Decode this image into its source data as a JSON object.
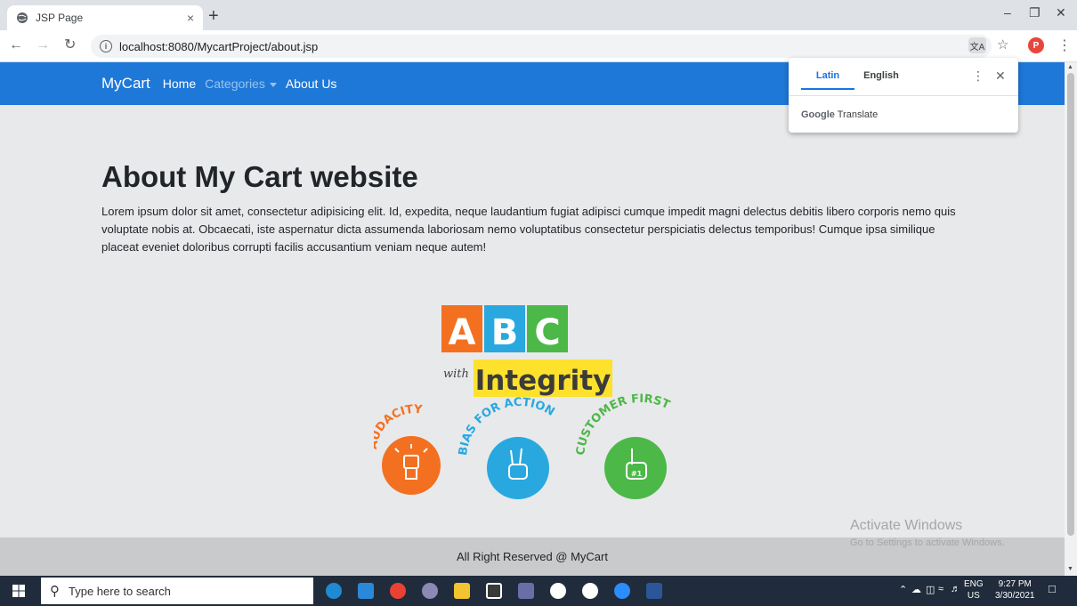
{
  "browser": {
    "tab_title": "JSP Page",
    "tab_close": "×",
    "new_tab": "+",
    "url": "localhost:8080/MycartProject/about.jsp",
    "profile_initial": "P",
    "translate_icon_text": "文A"
  },
  "site_nav": {
    "brand": "MyCart",
    "links": [
      "Home",
      "Categories",
      "About Us"
    ]
  },
  "page": {
    "heading": "About My Cart website",
    "paragraph": "Lorem ipsum dolor sit amet, consectetur adipisicing elit. Id, expedita, neque laudantium fugiat adipisci cumque impedit magni delectus debitis libero corporis nemo quis voluptate nobis at. Obcaecati, iste aspernatur dicta assumenda laboriosam nemo voluptatibus consectetur perspiciatis delectus temporibus! Cumque ipsa similique placeat eveniet doloribus corrupti facilis accusantium veniam neque autem!",
    "footer": "All Right Reserved @ MyCart"
  },
  "logo": {
    "letters": [
      "A",
      "B",
      "C"
    ],
    "with_text": "with",
    "integrity_text": "Integrity",
    "values": [
      "AUDACITY",
      "BIAS FOR ACTION",
      "CUSTOMER FIRST"
    ],
    "badge_number": "#1",
    "colors": {
      "orange": "#f37021",
      "blue": "#29a8e0",
      "green": "#4cb848",
      "yellow": "#fde12d"
    }
  },
  "translate_popup": {
    "tabs": [
      "Latin",
      "English"
    ],
    "footer_brand": "Google",
    "footer_word": "Translate"
  },
  "watermark": {
    "line1": "Activate Windows",
    "line2": "Go to Settings to activate Windows."
  },
  "taskbar": {
    "search_placeholder": "Type here to search",
    "lang_line1": "ENG",
    "lang_line2": "US",
    "time": "9:27 PM",
    "date": "3/30/2021"
  },
  "colors": {
    "navbar": "#1e78d8",
    "chrome_bg": "#dee1e6",
    "taskbar": "#202c3c"
  }
}
